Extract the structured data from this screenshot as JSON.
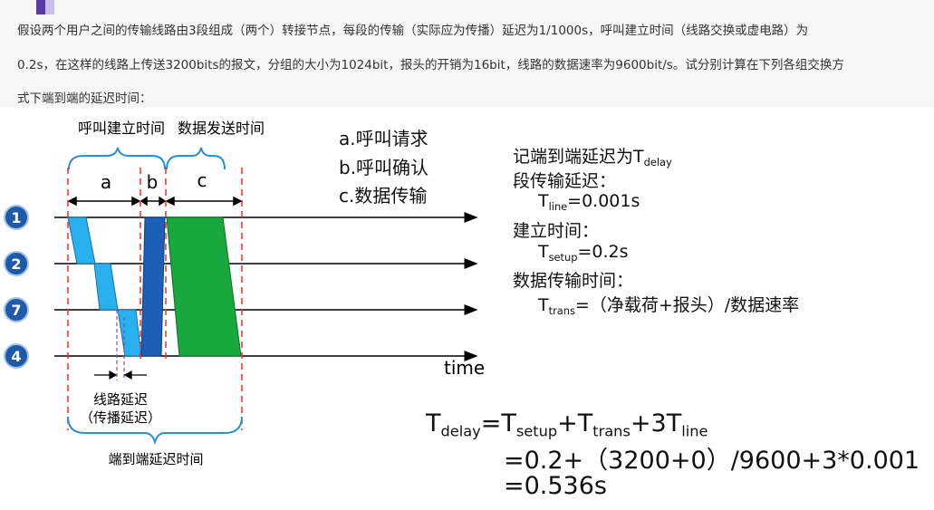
{
  "question": {
    "lines": [
      "假设两个用户之间的传输线路由3段组成（两个）转接节点，每段的传输（实际应为传播）延迟为1/1000s，呼叫建立时间（线路交换或虚电路）为",
      "0.2s，在这样的线路上传送3200bits的报文，分组的大小为1024bit，报头的开销为16bit，线路的数据速率为9600bit/s。试分别计算在下列各组交换方",
      "式下端到端的延迟时间："
    ]
  },
  "diagram": {
    "phase_setup_label": "呼叫建立时间",
    "phase_data_label": "数据发送时间",
    "seg_a": "a",
    "seg_b": "b",
    "seg_c": "c",
    "nodes": [
      "1",
      "2",
      "7",
      "4"
    ],
    "time_label": "time",
    "line_delay_1": "线路延迟",
    "line_delay_2": "（传播延迟）",
    "end_to_end_label": "端到端延迟时间",
    "colors": {
      "a_block": "#29b0ee",
      "b_block": "#1d5fb8",
      "c_block": "#18a83e",
      "dash_red": "#e53030",
      "brace_blue": "#2b8fd6",
      "node_fill": "#1e5aa8"
    }
  },
  "legend": {
    "a": "a.呼叫请求",
    "b": "b.呼叫确认",
    "c": "c.数据传输"
  },
  "notes": {
    "l1_text": "记端到端延迟为T",
    "l1_sub": "delay",
    "l2": "段传输延迟：",
    "l3_T": "T",
    "l3_sub": "line",
    "l3_val": "=0.001s",
    "l4": "建立时间：",
    "l5_T": "T",
    "l5_sub": "setup",
    "l5_val": "=0.2s",
    "l6": "数据传输时间：",
    "l7_T": "T",
    "l7_sub": "trans",
    "l7_val": "=（净载荷+报头）/数据速率"
  },
  "formula": {
    "T1": "T",
    "s1": "delay",
    "eq": "=",
    "T2": "T",
    "s2": "setup",
    "plus1": "+",
    "T3": "T",
    "s3": "trans",
    "plus2": "+3",
    "T4": "T",
    "s4": "line",
    "line2": "=0.2+（3200+0）/9600+3*0.001",
    "line3": "=0.536s"
  }
}
